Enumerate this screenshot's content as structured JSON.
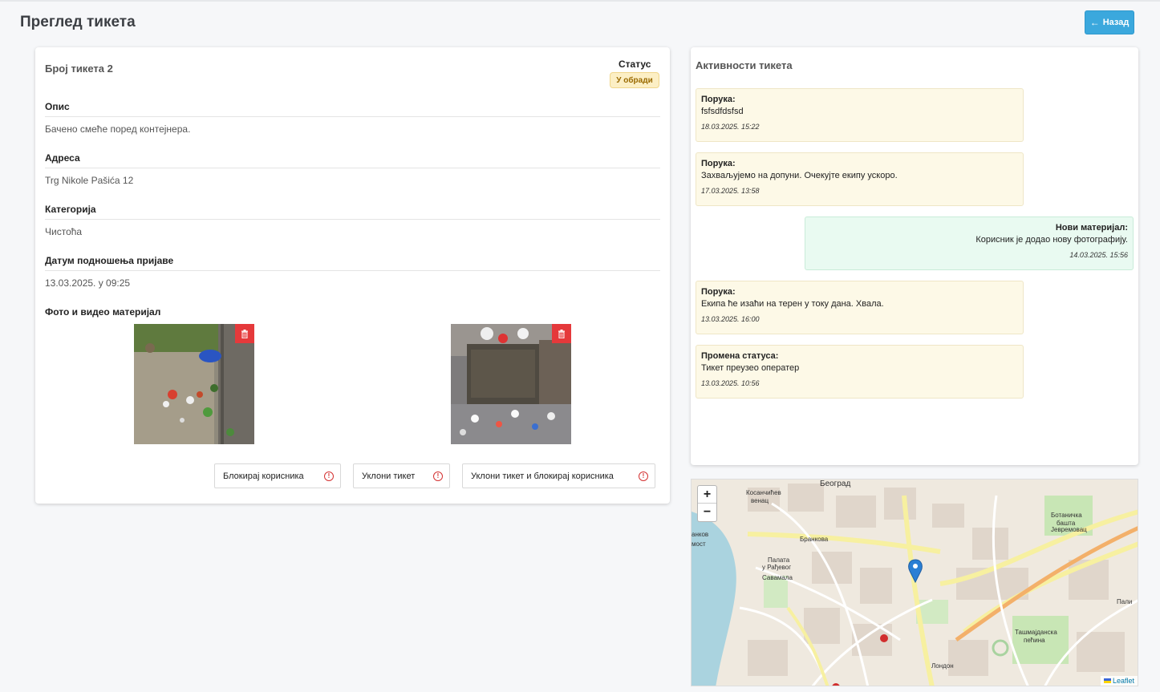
{
  "header": {
    "title": "Преглед тикета",
    "back_label": "Назад"
  },
  "ticket": {
    "number_label": "Број тикета 2",
    "status_label": "Статус",
    "status_value": "У обради",
    "description_label": "Опис",
    "description_value": "Бачено смеће поред контејнера.",
    "address_label": "Адреса",
    "address_value": "Trg Nikole Pašića 12",
    "category_label": "Категорија",
    "category_value": "Чистоћа",
    "date_label": "Датум подношења пријаве",
    "date_value": "13.03.2025. у 09:25",
    "media_label": "Фото и видео материјал"
  },
  "actions": {
    "block_user": "Блокирај корисника",
    "remove_ticket": "Уклони тикет",
    "remove_and_block": "Уклони тикет и блокирај корисника"
  },
  "activities": {
    "title": "Активности тикета",
    "items": [
      {
        "title": "Порука:",
        "text": "fsfsdfdsfsd",
        "time": "18.03.2025. 15:22",
        "side": "left"
      },
      {
        "title": "Порука:",
        "text": "Захваљујемо на допуни. Очекујте екипу ускоро.",
        "time": "17.03.2025. 13:58",
        "side": "left"
      },
      {
        "title": "Нови материјал:",
        "text": "Корисник је додао нову фотографију.",
        "time": "14.03.2025. 15:56",
        "side": "right"
      },
      {
        "title": "Порука:",
        "text": "Екипа ће изаћи на терен у току дана. Хвала.",
        "time": "13.03.2025. 16:00",
        "side": "left"
      },
      {
        "title": "Промена статуса:",
        "text": "Тикет преузео оператер",
        "time": "13.03.2025. 10:56",
        "side": "left"
      }
    ]
  },
  "map": {
    "zoom_in": "+",
    "zoom_out": "−",
    "attribution": "Leaflet",
    "labels": {
      "city": "Београд",
      "kosanc": "Косанчићев",
      "venac": "венац",
      "brank": "Бранкова",
      "savamala": "Савамала",
      "palata": "Палата",
      "rodjevo": "у Рађевог",
      "botan": "Ботаничка",
      "basta": "башта",
      "jevrem": "Јевремовац",
      "tasm": "Ташмајданска",
      "pecina": "пећина",
      "london": "Лондон",
      "most": "мост",
      "brank2": "анков",
      "pali": "Пали"
    }
  },
  "colors": {
    "accent": "#3ba8dd",
    "danger": "#e5393b",
    "status_bg": "#fcefc5",
    "msg_left_bg": "#fdf9e7",
    "msg_right_bg": "#e9faf1",
    "map_pin": "#2a7fd4"
  },
  "icons": {
    "back": "arrow-left-icon",
    "delete": "trash-icon",
    "warning": "exclamation-circle-icon",
    "pin": "map-marker-icon"
  }
}
